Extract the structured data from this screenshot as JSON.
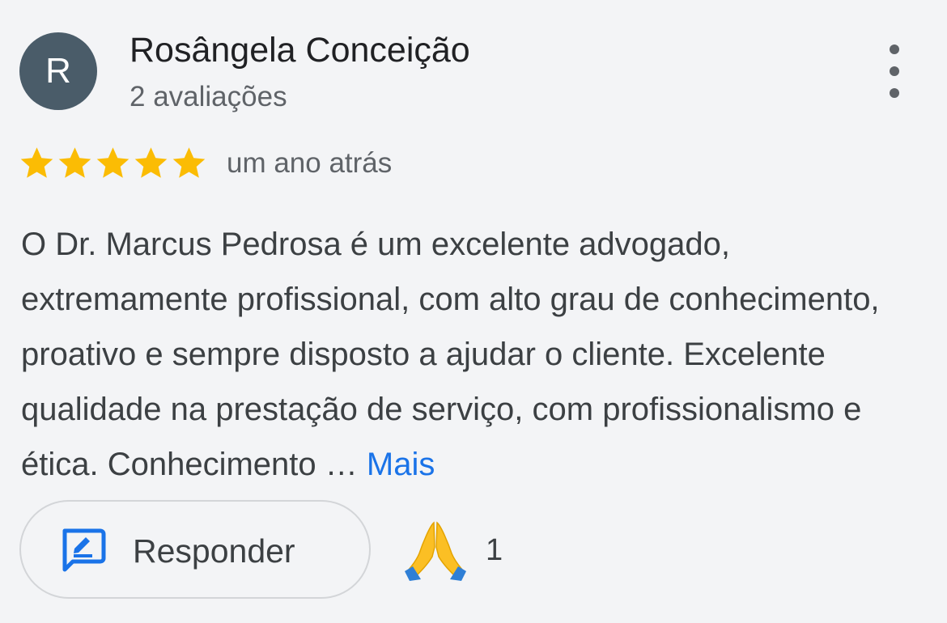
{
  "reviewer": {
    "avatar_letter": "R",
    "avatar_color": "#4a5c69",
    "name": "Rosângela Conceição",
    "reviews_count": "2 avaliações"
  },
  "menu": {
    "icon": "more-vert-icon"
  },
  "rating": {
    "stars": 5,
    "max_stars": 5,
    "star_color": "#fbbc04",
    "time": "um ano atrás"
  },
  "review": {
    "text": "O Dr. Marcus Pedrosa é um excelente advogado, extremamente profissional, com alto grau de conhecimento, proativo e sempre disposto a ajudar o cliente. Excelente qualidade na prestação de serviço, com profissionalismo e ética. Conhecimento …",
    "more_label": "Mais",
    "link_color": "#1a73e8"
  },
  "actions": {
    "reply_label": "Responder",
    "reply_icon": "reply-icon",
    "reply_icon_color": "#1a73e8",
    "reaction_icon": "folded-hands-icon",
    "reaction_count": "1"
  }
}
